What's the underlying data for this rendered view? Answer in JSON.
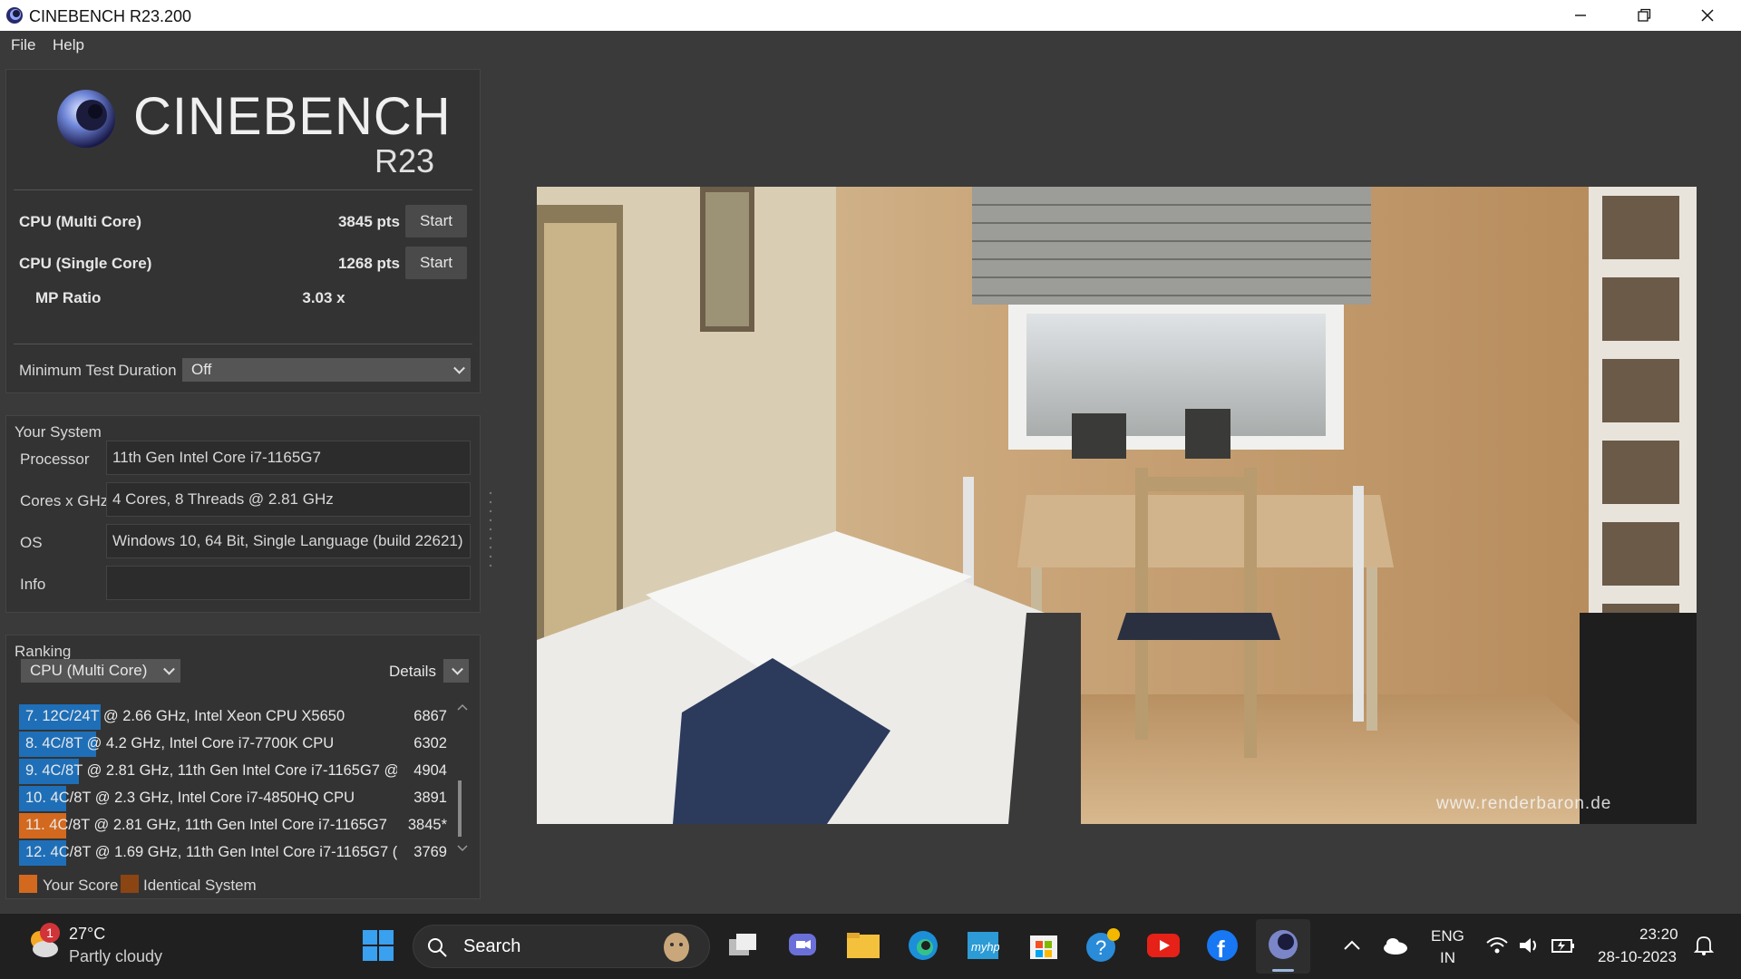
{
  "window": {
    "title": "CINEBENCH R23.200"
  },
  "menu": {
    "file": "File",
    "help": "Help"
  },
  "logo": {
    "name": "CINEBENCH",
    "version": "R23"
  },
  "bench": {
    "multi": {
      "label": "CPU (Multi Core)",
      "value": "3845 pts",
      "button": "Start"
    },
    "single": {
      "label": "CPU (Single Core)",
      "value": "1268 pts",
      "button": "Start"
    },
    "mp": {
      "label": "MP Ratio",
      "value": "3.03 x"
    }
  },
  "duration": {
    "label": "Minimum Test Duration",
    "value": "Off"
  },
  "system": {
    "title": "Your System",
    "processor_label": "Processor",
    "processor": "11th Gen Intel Core i7-1165G7",
    "cores_label": "Cores x GHz",
    "cores": "4 Cores, 8 Threads @ 2.81 GHz",
    "os_label": "OS",
    "os": "Windows 10, 64 Bit, Single Language (build 22621)",
    "info_label": "Info",
    "info": ""
  },
  "ranking": {
    "title": "Ranking",
    "mode": "CPU (Multi Core)",
    "details": "Details",
    "rows": [
      {
        "text": "7. 12C/24T @ 2.66 GHz, Intel Xeon CPU X5650",
        "score": "6867",
        "bar": 0.19,
        "color": "blue"
      },
      {
        "text": "8. 4C/8T @ 4.2 GHz, Intel Core i7-7700K CPU",
        "score": "6302",
        "bar": 0.18,
        "color": "blue"
      },
      {
        "text": "9. 4C/8T @ 2.81 GHz, 11th Gen Intel Core i7-1165G7 @",
        "score": "4904",
        "bar": 0.14,
        "color": "blue"
      },
      {
        "text": "10. 4C/8T @ 2.3 GHz, Intel Core i7-4850HQ CPU",
        "score": "3891",
        "bar": 0.11,
        "color": "blue"
      },
      {
        "text": "11. 4C/8T @ 2.81 GHz, 11th Gen Intel Core i7-1165G7",
        "score": "3845*",
        "bar": 0.11,
        "color": "orange"
      },
      {
        "text": "12. 4C/8T @ 1.69 GHz, 11th Gen Intel Core i7-1165G7 (",
        "score": "3769",
        "bar": 0.11,
        "color": "blue"
      }
    ],
    "legend_your": "Your Score",
    "legend_identical": "Identical System"
  },
  "render": {
    "watermark": "www.renderbaron.de"
  },
  "taskbar": {
    "weather_temp": "27°C",
    "weather_desc": "Partly cloudy",
    "weather_badge": "1",
    "search": "Search",
    "lang1": "ENG",
    "lang2": "IN",
    "time": "23:20",
    "date": "28-10-2023"
  }
}
